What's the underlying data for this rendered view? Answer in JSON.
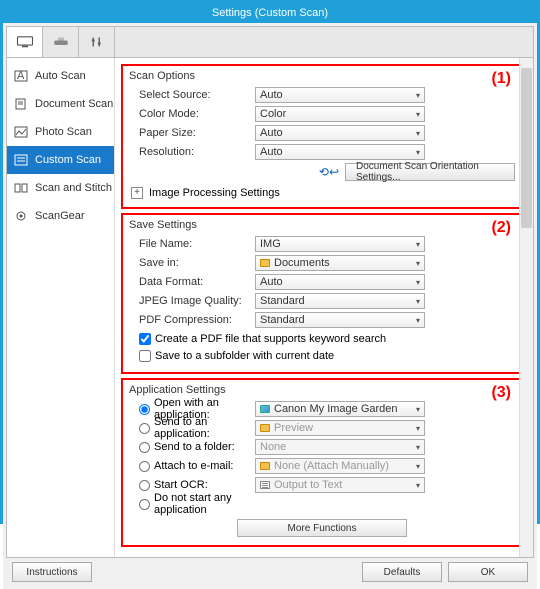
{
  "window": {
    "title": "Settings (Custom Scan)"
  },
  "tabs": [
    "monitor",
    "scanner",
    "tools"
  ],
  "sidebar": {
    "items": [
      {
        "label": "Auto Scan"
      },
      {
        "label": "Document Scan"
      },
      {
        "label": "Photo Scan"
      },
      {
        "label": "Custom Scan"
      },
      {
        "label": "Scan and Stitch"
      },
      {
        "label": "ScanGear"
      }
    ]
  },
  "annotations": {
    "s1": "(1)",
    "s2": "(2)",
    "s3": "(3)"
  },
  "scan_options": {
    "title": "Scan Options",
    "select_source": {
      "label": "Select Source:",
      "value": "Auto"
    },
    "color_mode": {
      "label": "Color Mode:",
      "value": "Color"
    },
    "paper_size": {
      "label": "Paper Size:",
      "value": "Auto"
    },
    "resolution": {
      "label": "Resolution:",
      "value": "Auto"
    },
    "orientation_btn": "Document Scan Orientation Settings...",
    "expand": "Image Processing Settings"
  },
  "save_settings": {
    "title": "Save Settings",
    "file_name": {
      "label": "File Name:",
      "value": "IMG"
    },
    "save_in": {
      "label": "Save in:",
      "value": "Documents"
    },
    "data_format": {
      "label": "Data Format:",
      "value": "Auto"
    },
    "jpeg": {
      "label": "JPEG Image Quality:",
      "value": "Standard"
    },
    "pdf": {
      "label": "PDF Compression:",
      "value": "Standard"
    },
    "chk_keyword": "Create a PDF file that supports keyword search",
    "chk_subfolder": "Save to a subfolder with current date"
  },
  "app_settings": {
    "title": "Application Settings",
    "open_app": {
      "label": "Open with an application:",
      "value": "Canon My Image Garden"
    },
    "send_app": {
      "label": "Send to an application:",
      "value": "Preview"
    },
    "send_fld": {
      "label": "Send to a folder:",
      "value": "None"
    },
    "attach": {
      "label": "Attach to e-mail:",
      "value": "None (Attach Manually)"
    },
    "ocr": {
      "label": "Start OCR:",
      "value": "Output to Text"
    },
    "none": {
      "label": "Do not start any application"
    },
    "more_btn": "More Functions"
  },
  "footer": {
    "instructions": "Instructions",
    "defaults": "Defaults",
    "ok": "OK"
  }
}
